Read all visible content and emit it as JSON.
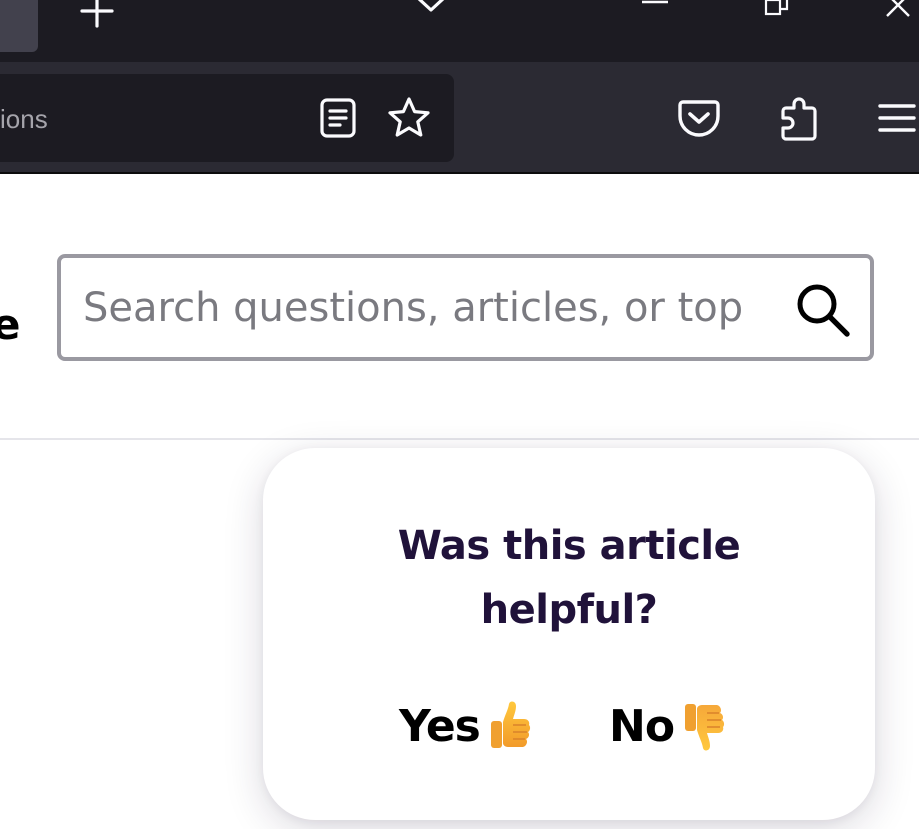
{
  "browser": {
    "url_text": "ions",
    "colors": {
      "tabbar_bg": "#1c1b22",
      "navbar_bg": "#2b2a33",
      "urlbar_bg": "#1c1b22",
      "icon": "#fbfbfe"
    },
    "icons": [
      "chevron-left-icon",
      "plus-icon",
      "chevron-down-icon",
      "minimize-icon",
      "restore-icon",
      "close-icon",
      "reader-view-icon",
      "star-icon",
      "pocket-icon",
      "extensions-icon",
      "hamburger-menu-icon"
    ]
  },
  "header": {
    "brand_visible_text": "e",
    "search": {
      "placeholder": "Search questions, articles, or top",
      "value": ""
    },
    "icons": [
      "search-icon"
    ]
  },
  "feedback": {
    "question": "Was this article helpful?",
    "yes_label": "Yes",
    "no_label": "No",
    "yes_icon": "thumbs-up-emoji",
    "no_icon": "thumbs-down-emoji",
    "colors": {
      "question": "#20123a",
      "buttons": "#000000",
      "emoji": "#f5a623"
    }
  }
}
